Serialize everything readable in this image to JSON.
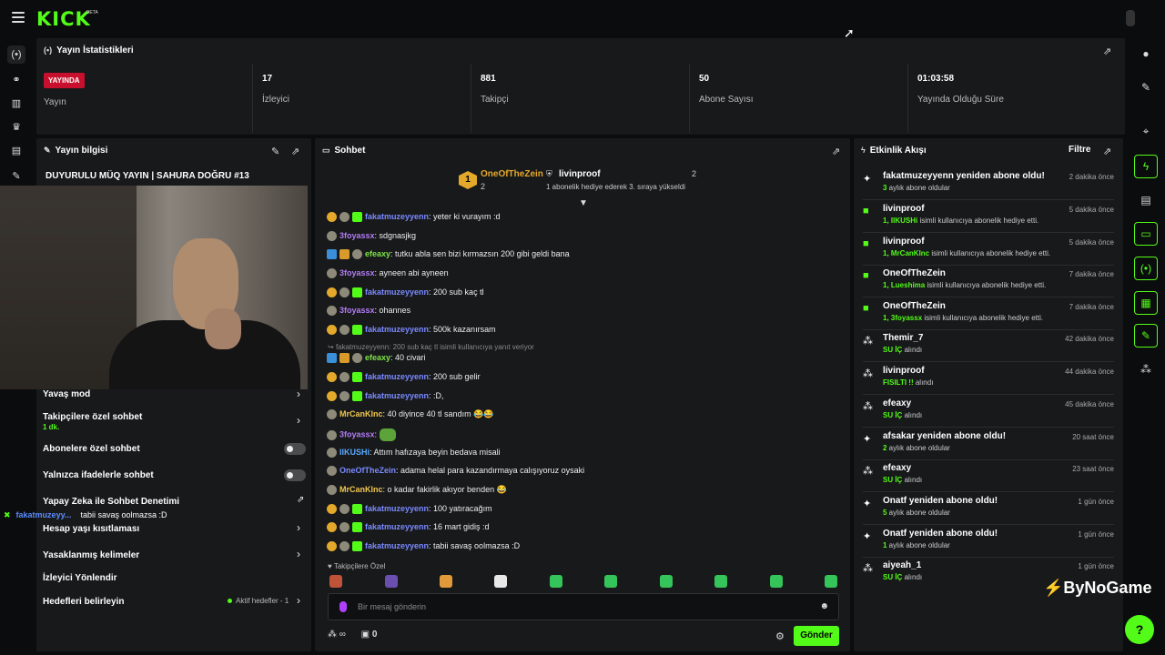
{
  "brand": {
    "logo": "KICK",
    "beta": "BETA",
    "accent": "#53fc18"
  },
  "stats": {
    "title": "Yayın İstatistikleri",
    "live_badge": "YAYINDA",
    "live_label": "Yayın",
    "items": [
      {
        "value": "17",
        "label": "İzleyici"
      },
      {
        "value": "881",
        "label": "Takipçi"
      },
      {
        "value": "50",
        "label": "Abone Sayısı"
      },
      {
        "value": "01:03:58",
        "label": "Yayında Olduğu Süre"
      }
    ]
  },
  "info": {
    "title": "Yayın bilgisi",
    "stream_title": "DUYURULU MÜQ YAYIN | SAHURA DOĞRU #13",
    "rows": {
      "slow": "Yavaş mod",
      "followers": "Takipçilere özel sohbet",
      "followers_sub": "1 dk.",
      "subs": "Abonelere özel sohbet",
      "emotes": "Yalnızca ifadelerle sohbet",
      "ai": "Yapay Zeka ile Sohbet Denetimi",
      "age": "Hesap yaşı kısıtlaması",
      "banned": "Yasaklanmış kelimeler",
      "redirect": "İzleyici Yönlendir",
      "goals": "Hedefleri belirleyin",
      "goals_active": "Aktif hedefler - 1"
    },
    "overlay_user": "fakatmuzeyy...",
    "overlay_text": "tabii savaş oolmazsa :D"
  },
  "chat": {
    "title": "Sohbet",
    "pinned": [
      {
        "rank": "1",
        "name": "OneOfTheZein",
        "count": "2"
      },
      {
        "name": "livinproof",
        "count": "2",
        "note": "1 abonelik hediye ederek 3. sıraya yükseldi"
      }
    ],
    "reply_hint": "fakatmuzeyyenn: 200 sub kaç tl isimli kullanıcıya yanıt veriyor",
    "messages": [
      {
        "user": "fakatmuzeyyenn",
        "text": ": yeter ki vurayım :d"
      },
      {
        "user": "3foyassx",
        "text": ": sdgnasjkg"
      },
      {
        "user": "efeaxy",
        "text": ": tutku abla sen bizi kırmazsın 200 gibi geldi bana"
      },
      {
        "user": "3foyassx",
        "text": ": ayneen abi ayneen"
      },
      {
        "user": "fakatmuzeyyenn",
        "text": ": 200 sub kaç tl"
      },
      {
        "user": "3foyassx",
        "text": ": ohannes"
      },
      {
        "user": "fakatmuzeyyenn",
        "text": ": 500k kazanırsam"
      },
      {
        "user": "efeaxy",
        "text": ": 40 civari"
      },
      {
        "user": "fakatmuzeyyenn",
        "text": ": 200 sub gelir"
      },
      {
        "user": "fakatmuzeyyenn",
        "text": ": :D,"
      },
      {
        "user": "MrCanKlnc",
        "text": ": 40 diyince 40 tl sandım 😂😂"
      },
      {
        "user": "3foyassx",
        "text": ":"
      },
      {
        "user": "IIKUSHi",
        "text": ": Attım hafızaya beyin bedava misali"
      },
      {
        "user": "OneOfTheZein",
        "text": ": adama helal para kazandırmaya calışıyoruz oysaki"
      },
      {
        "user": "MrCanKlnc",
        "text": ": o kadar fakirlik akıyor benden 😂"
      },
      {
        "user": "fakatmuzeyyenn",
        "text": ": 100 yatıracağım"
      },
      {
        "user": "fakatmuzeyyenn",
        "text": ": 16 mart gidiş :d"
      },
      {
        "user": "fakatmuzeyyenn",
        "text": ": tabii savaş oolmazsa :D"
      }
    ],
    "emotes_label": "Takipçilere Özel",
    "input_placeholder": "Bir mesaj gönderin",
    "points": "∞",
    "gifts": "0",
    "send": "Gönder"
  },
  "activity": {
    "title": "Etkinlik Akışı",
    "filter": "Filtre",
    "items": [
      {
        "icon": "sparkle",
        "name": "fakatmuzeyyenn yeniden abone oldu!",
        "sub_b": "3",
        "sub": " aylık abone oldular",
        "time": "2 dakika önce"
      },
      {
        "icon": "gift",
        "name": "livinproof",
        "sub_b": "1, IIKUSHi",
        "sub": " isimli kullanıcıya abonelik hediye etti.",
        "time": "5 dakika önce"
      },
      {
        "icon": "gift",
        "name": "livinproof",
        "sub_b": "1, MrCanKlnc",
        "sub": " isimli kullanıcıya abonelik hediye etti.",
        "time": "5 dakika önce"
      },
      {
        "icon": "gift",
        "name": "OneOfTheZein",
        "sub_b": "1, Lueshima",
        "sub": " isimli kullanıcıya abonelik hediye etti.",
        "time": "7 dakika önce"
      },
      {
        "icon": "gift",
        "name": "OneOfTheZein",
        "sub_b": "1, 3foyassx",
        "sub": " isimli kullanıcıya abonelik hediye etti.",
        "time": "7 dakika önce"
      },
      {
        "icon": "points",
        "name": "Themir_7",
        "sub_b": "SU İÇ",
        "sub": " alındı",
        "time": "42 dakika önce"
      },
      {
        "icon": "points",
        "name": "livinproof",
        "sub_b": "FISILTI !!",
        "sub": " alındı",
        "time": "44 dakika önce"
      },
      {
        "icon": "points",
        "name": "efeaxy",
        "sub_b": "SU İÇ",
        "sub": " alındı",
        "time": "45 dakika önce"
      },
      {
        "icon": "sparkle",
        "name": "afsakar yeniden abone oldu!",
        "sub_b": "2",
        "sub": " aylık abone oldular",
        "time": "20 saat önce"
      },
      {
        "icon": "points",
        "name": "efeaxy",
        "sub_b": "SU İÇ",
        "sub": " alındı",
        "time": "23 saat önce"
      },
      {
        "icon": "sparkle",
        "name": "Onatf yeniden abone oldu!",
        "sub_b": "5",
        "sub": " aylık abone oldular",
        "time": "1 gün önce"
      },
      {
        "icon": "sparkle",
        "name": "Onatf yeniden abone oldu!",
        "sub_b": "1",
        "sub": " aylık abone oldular",
        "time": "1 gün önce"
      },
      {
        "icon": "points",
        "name": "aiyeah_1",
        "sub_b": "SU İÇ",
        "sub": " alındı",
        "time": "1 gün önce"
      }
    ]
  },
  "watermark": {
    "pre": "ByNoGame"
  }
}
